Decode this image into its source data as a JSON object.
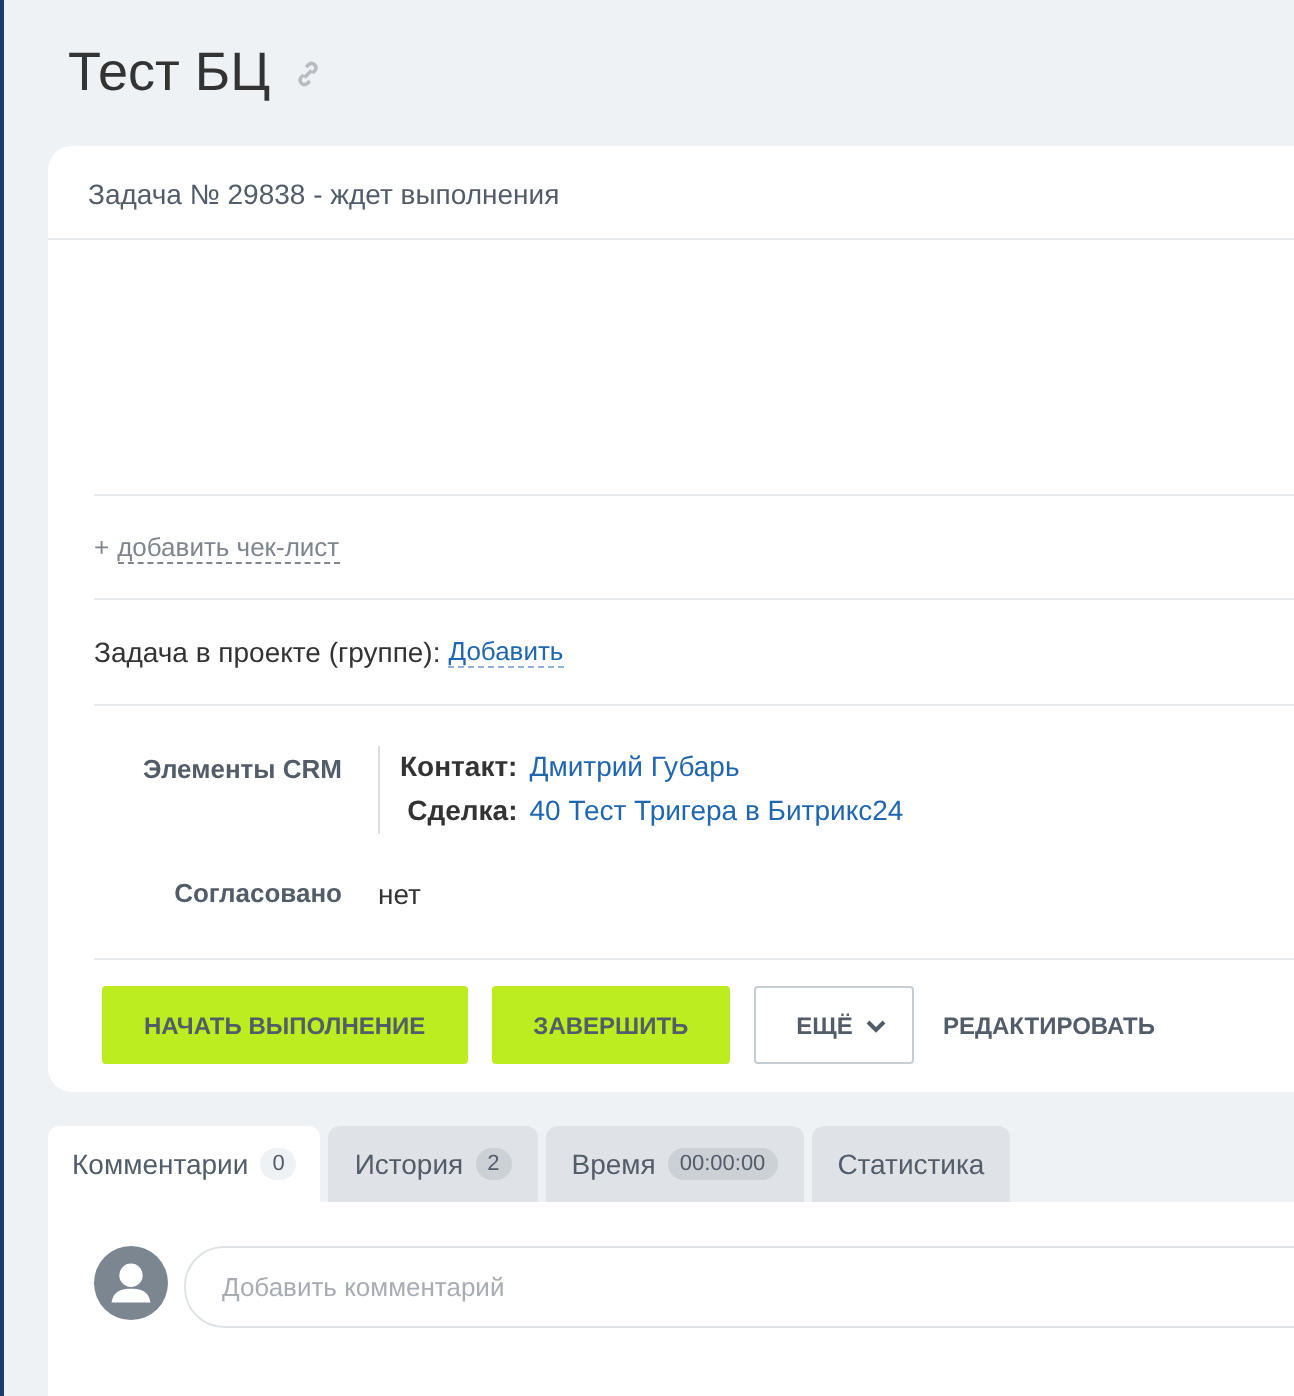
{
  "title": "Тест БЦ",
  "task_header": "Задача № 29838 - ждет выполнения",
  "checklist": {
    "plus": "+",
    "link": "добавить чек-лист"
  },
  "project": {
    "label": "Задача в проекте (группе):",
    "link": "Добавить"
  },
  "crm": {
    "label": "Элементы CRM",
    "items": [
      {
        "label": "Контакт:",
        "value": "Дмитрий Губарь"
      },
      {
        "label": "Сделка:",
        "value": "40 Тест Тригера в Битрикс24"
      }
    ]
  },
  "approved": {
    "label": "Согласовано",
    "value": "нет"
  },
  "buttons": [
    {
      "label": "НАЧАТЬ ВЫПОЛНЕНИЕ",
      "kind": "primary"
    },
    {
      "label": "ЗАВЕРШИТЬ",
      "kind": "primary"
    },
    {
      "label": "ЕЩЁ",
      "kind": "dropdown"
    },
    {
      "label": "РЕДАКТИРОВАТЬ",
      "kind": "link"
    }
  ],
  "tabs": [
    {
      "label": "Комментарии",
      "count": "0",
      "selected": true
    },
    {
      "label": "История",
      "count": "2",
      "selected": false
    },
    {
      "label": "Время",
      "count": "00:00:00",
      "selected": false
    },
    {
      "label": "Статистика",
      "selected": false
    }
  ],
  "comment": {
    "placeholder": "Добавить комментарий"
  }
}
